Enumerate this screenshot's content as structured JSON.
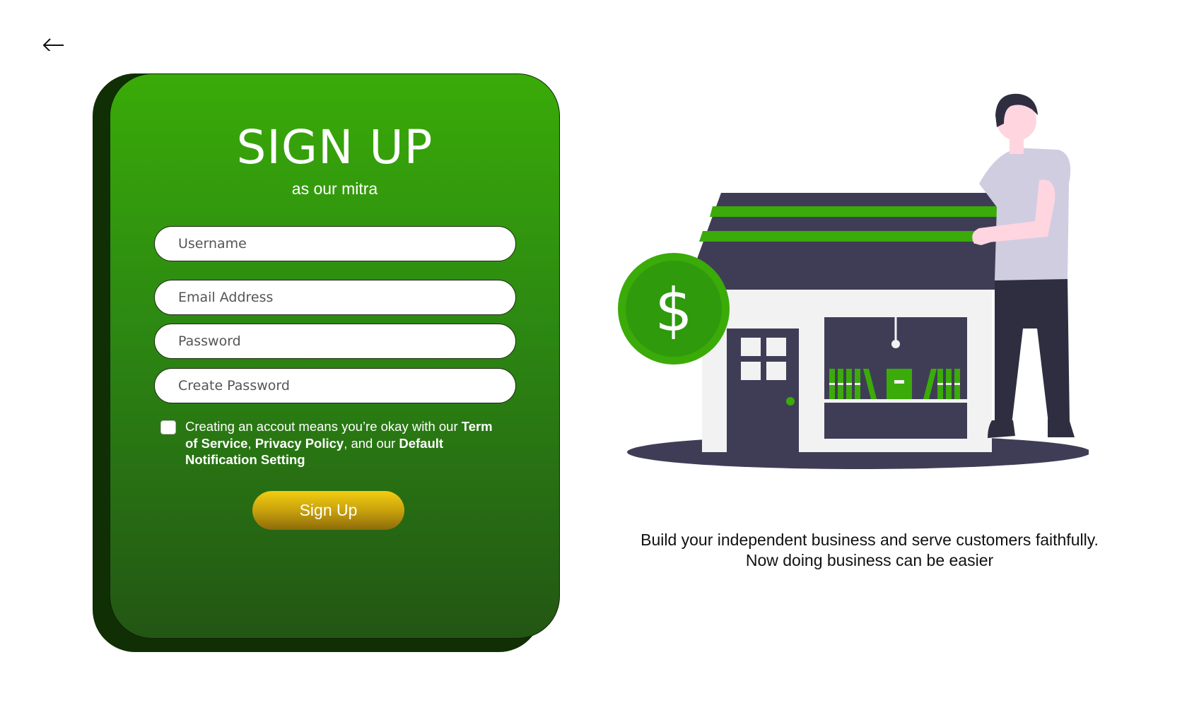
{
  "nav": {
    "back_icon": "arrow-left-icon"
  },
  "form": {
    "title": "SIGN UP",
    "subtitle": "as our mitra",
    "fields": [
      {
        "placeholder": "Username"
      },
      {
        "placeholder": "Email Address"
      },
      {
        "placeholder": "Password"
      },
      {
        "placeholder": "Create Password"
      }
    ],
    "terms": {
      "prefix": "Creating an accout means you’re okay with our ",
      "term_link": "Term of Service",
      "sep1": ", ",
      "privacy_link": "Privacy Policy",
      "sep2": ", and our ",
      "notification_link": "Default Notification Setting",
      "checked": false
    },
    "submit_label": "Sign Up"
  },
  "illustration": {
    "icon": "storefront-person-illustration",
    "coin_symbol": "$"
  },
  "tagline": {
    "line1": "Build your independent business and serve customers faithfully.",
    "line2": "Now doing business can be easier"
  },
  "colors": {
    "primary_green": "#3aab08",
    "dark_green": "#112f05",
    "button_gold": "#f2cd10",
    "house_dark": "#3f3d56"
  }
}
